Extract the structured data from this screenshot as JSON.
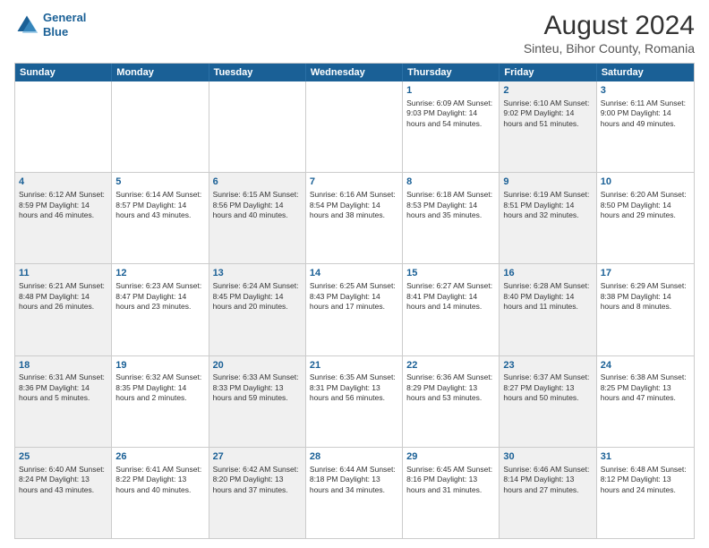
{
  "header": {
    "logo_line1": "General",
    "logo_line2": "Blue",
    "main_title": "August 2024",
    "subtitle": "Sinteu, Bihor County, Romania"
  },
  "calendar": {
    "days_of_week": [
      "Sunday",
      "Monday",
      "Tuesday",
      "Wednesday",
      "Thursday",
      "Friday",
      "Saturday"
    ],
    "rows": [
      [
        {
          "day": "",
          "text": "",
          "shaded": false
        },
        {
          "day": "",
          "text": "",
          "shaded": false
        },
        {
          "day": "",
          "text": "",
          "shaded": false
        },
        {
          "day": "",
          "text": "",
          "shaded": false
        },
        {
          "day": "1",
          "text": "Sunrise: 6:09 AM\nSunset: 9:03 PM\nDaylight: 14 hours\nand 54 minutes.",
          "shaded": false
        },
        {
          "day": "2",
          "text": "Sunrise: 6:10 AM\nSunset: 9:02 PM\nDaylight: 14 hours\nand 51 minutes.",
          "shaded": true
        },
        {
          "day": "3",
          "text": "Sunrise: 6:11 AM\nSunset: 9:00 PM\nDaylight: 14 hours\nand 49 minutes.",
          "shaded": false
        }
      ],
      [
        {
          "day": "4",
          "text": "Sunrise: 6:12 AM\nSunset: 8:59 PM\nDaylight: 14 hours\nand 46 minutes.",
          "shaded": true
        },
        {
          "day": "5",
          "text": "Sunrise: 6:14 AM\nSunset: 8:57 PM\nDaylight: 14 hours\nand 43 minutes.",
          "shaded": false
        },
        {
          "day": "6",
          "text": "Sunrise: 6:15 AM\nSunset: 8:56 PM\nDaylight: 14 hours\nand 40 minutes.",
          "shaded": true
        },
        {
          "day": "7",
          "text": "Sunrise: 6:16 AM\nSunset: 8:54 PM\nDaylight: 14 hours\nand 38 minutes.",
          "shaded": false
        },
        {
          "day": "8",
          "text": "Sunrise: 6:18 AM\nSunset: 8:53 PM\nDaylight: 14 hours\nand 35 minutes.",
          "shaded": false
        },
        {
          "day": "9",
          "text": "Sunrise: 6:19 AM\nSunset: 8:51 PM\nDaylight: 14 hours\nand 32 minutes.",
          "shaded": true
        },
        {
          "day": "10",
          "text": "Sunrise: 6:20 AM\nSunset: 8:50 PM\nDaylight: 14 hours\nand 29 minutes.",
          "shaded": false
        }
      ],
      [
        {
          "day": "11",
          "text": "Sunrise: 6:21 AM\nSunset: 8:48 PM\nDaylight: 14 hours\nand 26 minutes.",
          "shaded": true
        },
        {
          "day": "12",
          "text": "Sunrise: 6:23 AM\nSunset: 8:47 PM\nDaylight: 14 hours\nand 23 minutes.",
          "shaded": false
        },
        {
          "day": "13",
          "text": "Sunrise: 6:24 AM\nSunset: 8:45 PM\nDaylight: 14 hours\nand 20 minutes.",
          "shaded": true
        },
        {
          "day": "14",
          "text": "Sunrise: 6:25 AM\nSunset: 8:43 PM\nDaylight: 14 hours\nand 17 minutes.",
          "shaded": false
        },
        {
          "day": "15",
          "text": "Sunrise: 6:27 AM\nSunset: 8:41 PM\nDaylight: 14 hours\nand 14 minutes.",
          "shaded": false
        },
        {
          "day": "16",
          "text": "Sunrise: 6:28 AM\nSunset: 8:40 PM\nDaylight: 14 hours\nand 11 minutes.",
          "shaded": true
        },
        {
          "day": "17",
          "text": "Sunrise: 6:29 AM\nSunset: 8:38 PM\nDaylight: 14 hours\nand 8 minutes.",
          "shaded": false
        }
      ],
      [
        {
          "day": "18",
          "text": "Sunrise: 6:31 AM\nSunset: 8:36 PM\nDaylight: 14 hours\nand 5 minutes.",
          "shaded": true
        },
        {
          "day": "19",
          "text": "Sunrise: 6:32 AM\nSunset: 8:35 PM\nDaylight: 14 hours\nand 2 minutes.",
          "shaded": false
        },
        {
          "day": "20",
          "text": "Sunrise: 6:33 AM\nSunset: 8:33 PM\nDaylight: 13 hours\nand 59 minutes.",
          "shaded": true
        },
        {
          "day": "21",
          "text": "Sunrise: 6:35 AM\nSunset: 8:31 PM\nDaylight: 13 hours\nand 56 minutes.",
          "shaded": false
        },
        {
          "day": "22",
          "text": "Sunrise: 6:36 AM\nSunset: 8:29 PM\nDaylight: 13 hours\nand 53 minutes.",
          "shaded": false
        },
        {
          "day": "23",
          "text": "Sunrise: 6:37 AM\nSunset: 8:27 PM\nDaylight: 13 hours\nand 50 minutes.",
          "shaded": true
        },
        {
          "day": "24",
          "text": "Sunrise: 6:38 AM\nSunset: 8:25 PM\nDaylight: 13 hours\nand 47 minutes.",
          "shaded": false
        }
      ],
      [
        {
          "day": "25",
          "text": "Sunrise: 6:40 AM\nSunset: 8:24 PM\nDaylight: 13 hours\nand 43 minutes.",
          "shaded": true
        },
        {
          "day": "26",
          "text": "Sunrise: 6:41 AM\nSunset: 8:22 PM\nDaylight: 13 hours\nand 40 minutes.",
          "shaded": false
        },
        {
          "day": "27",
          "text": "Sunrise: 6:42 AM\nSunset: 8:20 PM\nDaylight: 13 hours\nand 37 minutes.",
          "shaded": true
        },
        {
          "day": "28",
          "text": "Sunrise: 6:44 AM\nSunset: 8:18 PM\nDaylight: 13 hours\nand 34 minutes.",
          "shaded": false
        },
        {
          "day": "29",
          "text": "Sunrise: 6:45 AM\nSunset: 8:16 PM\nDaylight: 13 hours\nand 31 minutes.",
          "shaded": false
        },
        {
          "day": "30",
          "text": "Sunrise: 6:46 AM\nSunset: 8:14 PM\nDaylight: 13 hours\nand 27 minutes.",
          "shaded": true
        },
        {
          "day": "31",
          "text": "Sunrise: 6:48 AM\nSunset: 8:12 PM\nDaylight: 13 hours\nand 24 minutes.",
          "shaded": false
        }
      ]
    ]
  }
}
